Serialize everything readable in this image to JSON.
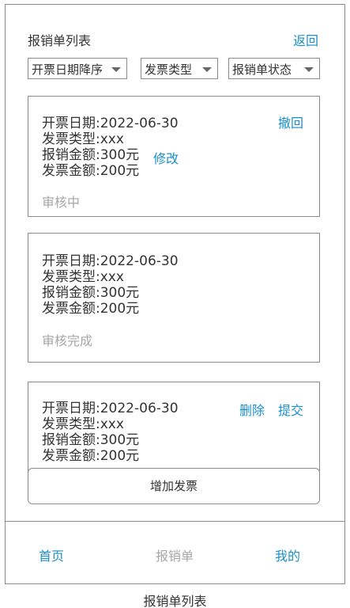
{
  "header": {
    "title": "报销单列表",
    "back_label": "返回"
  },
  "filters": {
    "date_sort": "开票日期降序",
    "invoice_type": "发票类型",
    "report_status": "报销单状态"
  },
  "cards": [
    {
      "invoice_date": "开票日期:2022-06-30",
      "invoice_type": "发票类型:xxx",
      "reimburse_amount": "报销金额:300元",
      "invoice_amount": "发票金额:200元",
      "status": "审核中",
      "actions": {
        "withdraw": "撤回",
        "edit": "修改"
      }
    },
    {
      "invoice_date": "开票日期:2022-06-30",
      "invoice_type": "发票类型:xxx",
      "reimburse_amount": "报销金额:300元",
      "invoice_amount": "发票金额:200元",
      "status": "审核完成"
    },
    {
      "invoice_date": "开票日期:2022-06-30",
      "invoice_type": "发票类型:xxx",
      "reimburse_amount": "报销金额:300元",
      "invoice_amount": "发票金额:200元",
      "actions": {
        "delete": "删除",
        "submit": "提交"
      }
    }
  ],
  "add_invoice_label": "增加发票",
  "tabbar": {
    "home": "首页",
    "reimburse": "报销单",
    "mine": "我的"
  },
  "caption": "报销单列表",
  "colors": {
    "accent": "#1a8fc9",
    "muted": "#a6a6a6",
    "border": "#8c8c8c",
    "text": "#333333"
  }
}
